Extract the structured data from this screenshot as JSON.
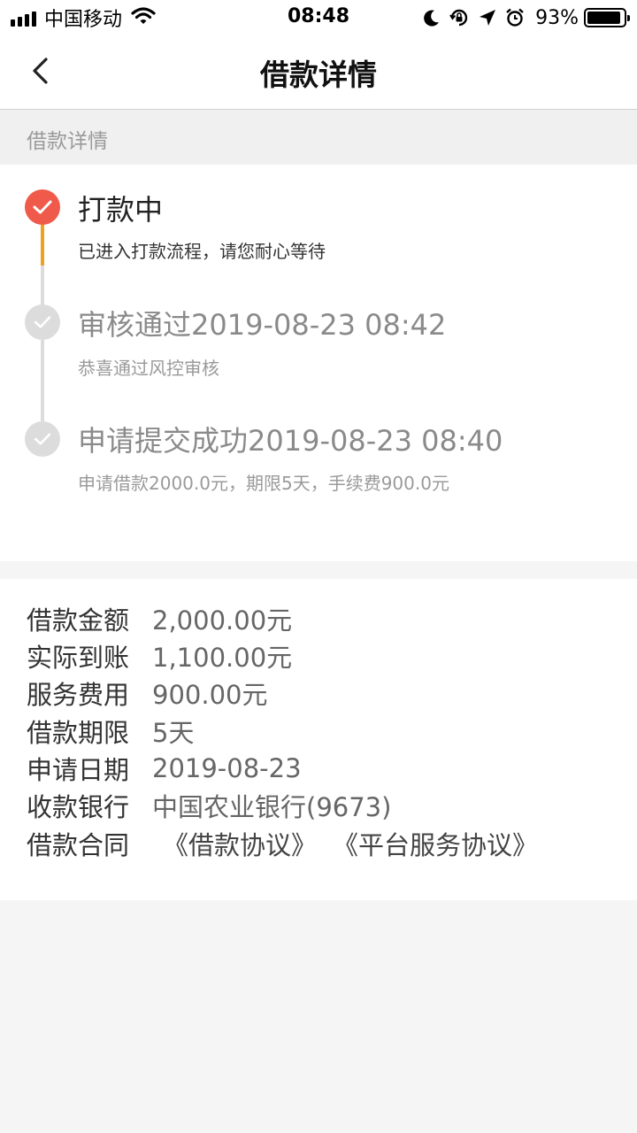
{
  "status_bar": {
    "carrier": "中国移动",
    "time": "08:48",
    "battery_percent": "93%",
    "battery_level": 0.93
  },
  "nav": {
    "title": "借款详情"
  },
  "section": {
    "label": "借款详情"
  },
  "timeline": [
    {
      "title": "打款中",
      "subtitle": "已进入打款流程，请您耐心等待",
      "active": true
    },
    {
      "title": "审核通过2019-08-23 08:42",
      "subtitle": "恭喜通过风控审核",
      "active": false
    },
    {
      "title": "申请提交成功2019-08-23 08:40",
      "subtitle": "申请借款2000.0元，期限5天，手续费900.0元",
      "active": false
    }
  ],
  "details": {
    "amount": {
      "label": "借款金额",
      "value": "2,000.00元"
    },
    "received": {
      "label": "实际到账",
      "value": "1,100.00元"
    },
    "fee": {
      "label": "服务费用",
      "value": "900.00元"
    },
    "term": {
      "label": "借款期限",
      "value": "5天"
    },
    "date": {
      "label": "申请日期",
      "value": "2019-08-23"
    },
    "bank": {
      "label": "收款银行",
      "value": "中国农业银行(9673)"
    },
    "contract": {
      "label": "借款合同",
      "links": [
        "《借款协议》",
        "《平台服务协议》"
      ]
    }
  },
  "colors": {
    "accent_red": "#f05a4a",
    "progress_orange": "#f0a020",
    "inactive_gray": "#dcdcdc"
  }
}
